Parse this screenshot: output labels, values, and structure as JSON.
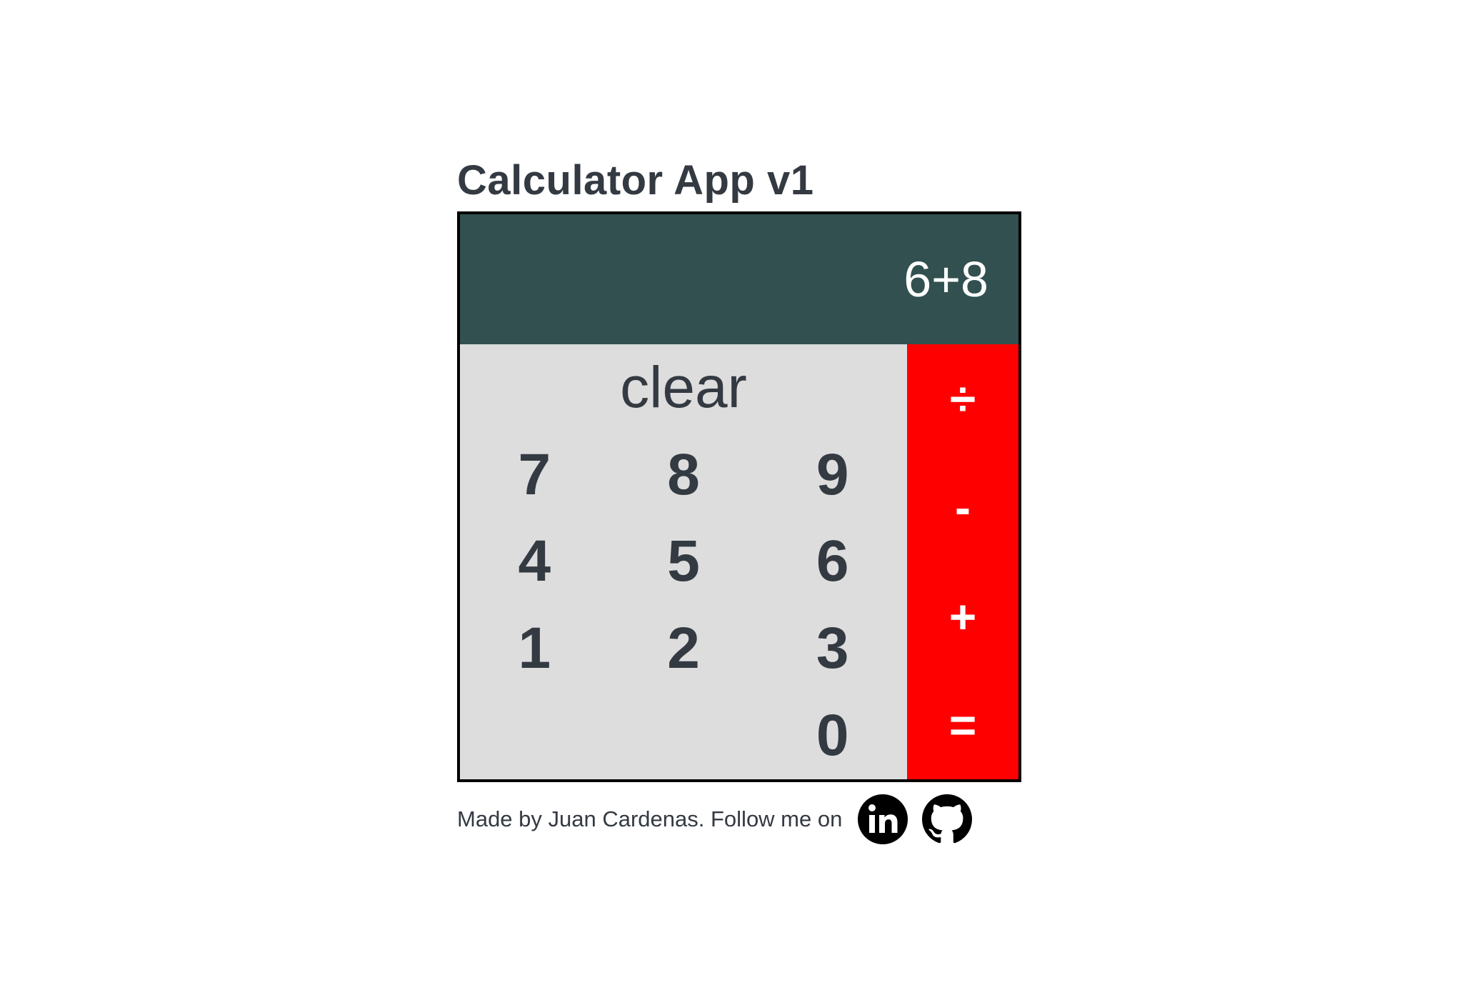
{
  "page": {
    "title": "Calculator App v1"
  },
  "display": {
    "value": "6+8"
  },
  "keypad": {
    "clear_label": "clear",
    "digits": [
      "7",
      "8",
      "9",
      "4",
      "5",
      "6",
      "1",
      "2",
      "3",
      "0"
    ]
  },
  "operators": {
    "divide": "÷",
    "subtract": "-",
    "add": "+",
    "equals": "="
  },
  "footer": {
    "text": "Made by Juan Cardenas. Follow me on",
    "icons": [
      "linkedin-icon",
      "github-icon"
    ]
  },
  "colors": {
    "display_bg": "#325050",
    "keypad_bg": "#dddddd",
    "operator_bg": "#ff0000",
    "text_dark": "#343a42"
  }
}
